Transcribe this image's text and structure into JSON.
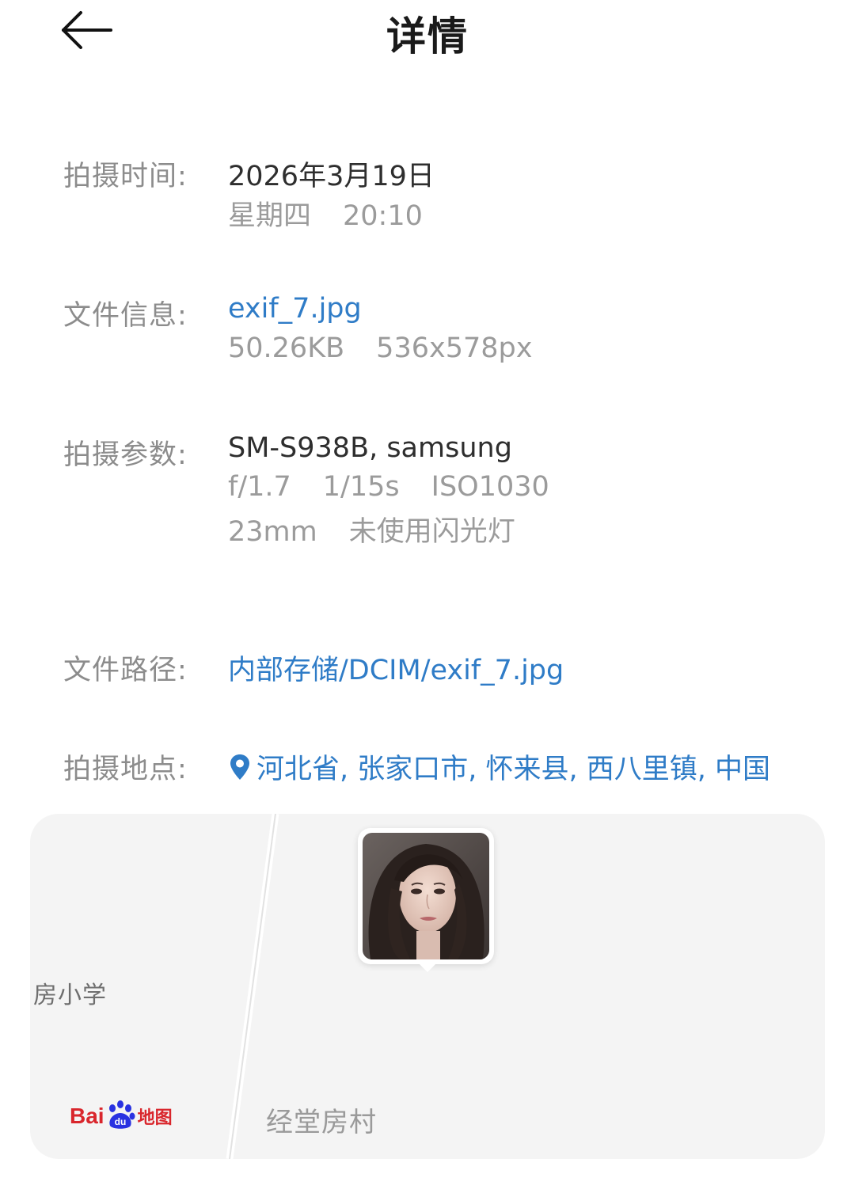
{
  "header": {
    "title": "详情",
    "back_icon": "arrow-left-icon"
  },
  "capture_time": {
    "label": "拍摄时间:",
    "date": "2026年3月19日",
    "weekday": "星期四",
    "time": "20:10"
  },
  "file_info": {
    "label": "文件信息:",
    "file_name": "exif_7.jpg",
    "file_size": "50.26KB",
    "dimensions": "536x578px"
  },
  "capture_params": {
    "label": "拍摄参数:",
    "device": "SM-S938B, samsung",
    "aperture": "f/1.7",
    "shutter": "1/15s",
    "iso": "ISO1030",
    "focal_length": "23mm",
    "flash": "未使用闪光灯"
  },
  "file_path": {
    "label": "文件路径:",
    "path": "内部存储/DCIM/exif_7.jpg"
  },
  "location": {
    "label": "拍摄地点:",
    "icon": "location-pin-icon",
    "address": "河北省, 张家口市, 怀来县, 西八里镇, 中国"
  },
  "map": {
    "poi_left": "房小学",
    "poi_bottom": "经堂房村",
    "provider_text": "Bai",
    "provider_du": "du",
    "provider_map": "地图"
  },
  "colors": {
    "link": "#2f7cc7",
    "label": "#8c8c8c",
    "muted": "#9b9b9b",
    "map_bg": "#f4f4f4",
    "baidu_red": "#d9262c",
    "baidu_blue": "#2932e1"
  }
}
